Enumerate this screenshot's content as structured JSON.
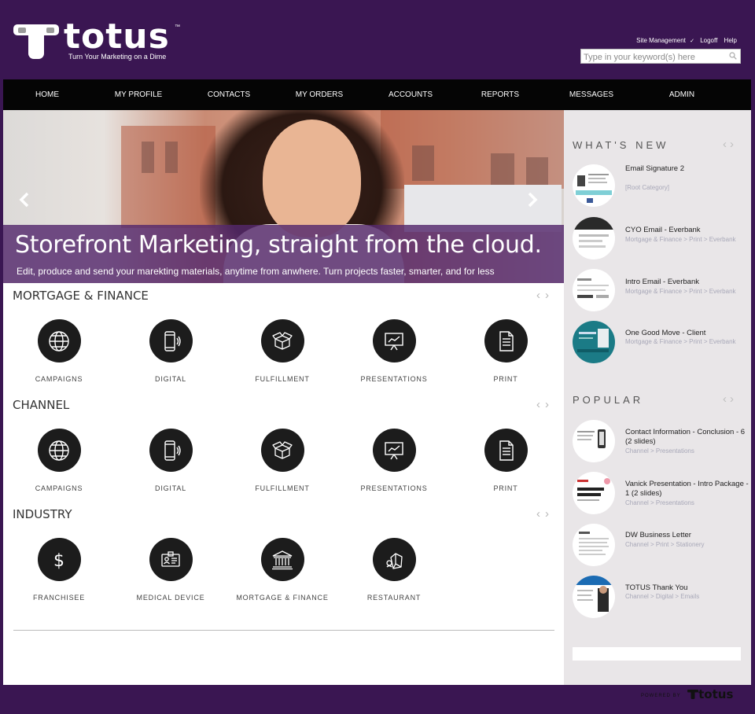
{
  "brand": {
    "name": "totus",
    "trademark": "™",
    "tagline": "Turn Your Marketing on a Dime",
    "accent": "#3a1652"
  },
  "utility": {
    "links": [
      "Site Management",
      "Logoff",
      "Help"
    ],
    "separator": "✓"
  },
  "search": {
    "placeholder": "Type in your keyword(s) here",
    "icon": "search-icon"
  },
  "nav": {
    "items": [
      "HOME",
      "MY PROFILE",
      "CONTACTS",
      "MY ORDERS",
      "ACCOUNTS",
      "REPORTS",
      "MESSAGES",
      "ADMIN"
    ]
  },
  "hero": {
    "title": "Storefront Marketing, straight from the cloud.",
    "subtitle": "Edit, produce and send your marekting materials, anytime from anwhere. Turn projects faster, smarter, and for less",
    "prev_icon": "chevron-left-icon",
    "next_icon": "chevron-right-icon"
  },
  "sections": [
    {
      "title": "MORTGAGE & FINANCE",
      "items": [
        {
          "label": "CAMPAIGNS",
          "icon": "globe-icon"
        },
        {
          "label": "DIGITAL",
          "icon": "phone-icon"
        },
        {
          "label": "FULFILLMENT",
          "icon": "box-icon"
        },
        {
          "label": "PRESENTATIONS",
          "icon": "presentation-icon"
        },
        {
          "label": "PRINT",
          "icon": "document-icon"
        }
      ]
    },
    {
      "title": "CHANNEL",
      "items": [
        {
          "label": "CAMPAIGNS",
          "icon": "globe-icon"
        },
        {
          "label": "DIGITAL",
          "icon": "phone-icon"
        },
        {
          "label": "FULFILLMENT",
          "icon": "box-icon"
        },
        {
          "label": "PRESENTATIONS",
          "icon": "presentation-icon"
        },
        {
          "label": "PRINT",
          "icon": "document-icon"
        }
      ]
    },
    {
      "title": "INDUSTRY",
      "items": [
        {
          "label": "FRANCHISEE",
          "icon": "dollar-icon"
        },
        {
          "label": "MEDICAL DEVICE",
          "icon": "id-card-icon"
        },
        {
          "label": "MORTGAGE & FINANCE",
          "icon": "bank-icon"
        },
        {
          "label": "RESTAURANT",
          "icon": "takeout-icon"
        }
      ]
    }
  ],
  "whats_new": {
    "title": "WHAT'S NEW",
    "items": [
      {
        "name": "Email Signature 2",
        "path": "[Root Category]"
      },
      {
        "name": "CYO Email - Everbank",
        "path": "Mortgage & Finance > Print > Everbank"
      },
      {
        "name": "Intro Email - Everbank",
        "path": "Mortgage & Finance > Print > Everbank"
      },
      {
        "name": "One Good Move - Client",
        "path": "Mortgage & Finance > Print > Everbank"
      }
    ]
  },
  "popular": {
    "title": "POPULAR",
    "items": [
      {
        "name": "Contact Information - Conclusion - 6 (2 slides)",
        "path": "Channel > Presentations"
      },
      {
        "name": "Vanick Presentation - Intro Package - 1 (2 slides)",
        "path": "Channel > Presentations"
      },
      {
        "name": "DW Business Letter",
        "path": "Channel > Print > Stationery"
      },
      {
        "name": "TOTUS Thank You",
        "path": "Channel > Digital > Emails"
      }
    ]
  },
  "footer": {
    "powered_by": "POWERED BY",
    "brand": "totus"
  }
}
